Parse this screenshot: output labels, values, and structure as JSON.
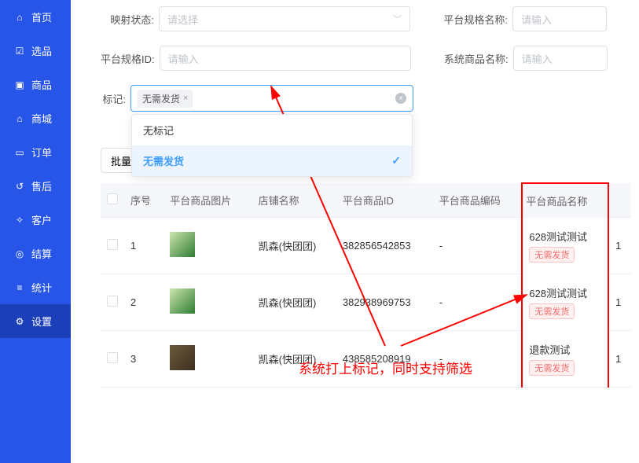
{
  "sidebar": {
    "items": [
      {
        "label": "首页",
        "icon": "⌂"
      },
      {
        "label": "选品",
        "icon": "☑"
      },
      {
        "label": "商品",
        "icon": "▣"
      },
      {
        "label": "商城",
        "icon": "⌂"
      },
      {
        "label": "订单",
        "icon": "▭"
      },
      {
        "label": "售后",
        "icon": "↺"
      },
      {
        "label": "客户",
        "icon": "✧"
      },
      {
        "label": "结算",
        "icon": "◎"
      },
      {
        "label": "统计",
        "icon": "≡"
      },
      {
        "label": "设置",
        "icon": "⚙"
      }
    ],
    "active_index": 9
  },
  "filters": {
    "mapping_status": {
      "label": "映射状态:",
      "placeholder": "请选择"
    },
    "platform_spec_name": {
      "label": "平台规格名称:",
      "placeholder": "请输入"
    },
    "platform_spec_id": {
      "label": "平台规格ID:",
      "placeholder": "请输入"
    },
    "system_prod_name": {
      "label": "系统商品名称:",
      "placeholder": "请输入"
    },
    "tag": {
      "label": "标记:",
      "selected_tag": "无需发货",
      "options": [
        {
          "label": "无标记",
          "selected": false
        },
        {
          "label": "无需发货",
          "selected": true
        }
      ]
    }
  },
  "batch_button": "批量操",
  "table": {
    "headers": [
      "",
      "序号",
      "平台商品图片",
      "店铺名称",
      "平台商品ID",
      "平台商品编码",
      "平台商品名称",
      ""
    ],
    "rows": [
      {
        "seq": "1",
        "shop": "凯森(快团团)",
        "pid": "382856542853",
        "pcode": "-",
        "name": "628测试测试",
        "tag": "无需发货",
        "last": "1"
      },
      {
        "seq": "2",
        "shop": "凯森(快团团)",
        "pid": "382938969753",
        "pcode": "-",
        "name": "628测试测试",
        "tag": "无需发货",
        "last": "1"
      },
      {
        "seq": "3",
        "shop": "凯森(快团团)",
        "pid": "438585208919",
        "pcode": "-",
        "name": "退款测试",
        "tag": "无需发货",
        "last": "1"
      }
    ]
  },
  "annotation": "系统打上标记，同时支持筛选"
}
